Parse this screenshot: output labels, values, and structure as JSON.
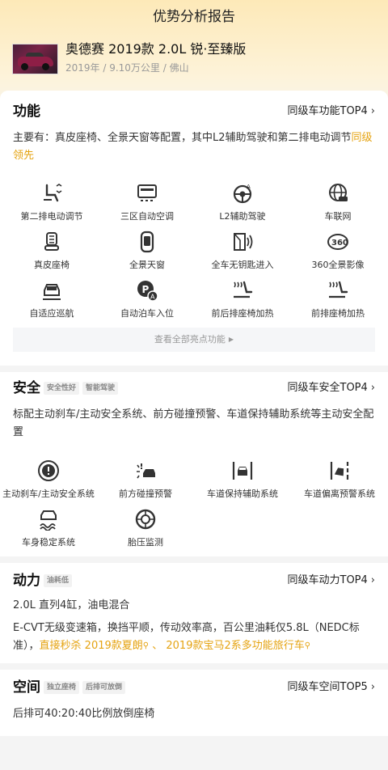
{
  "page": {
    "title": "优势分析报告"
  },
  "car": {
    "name": "奥德赛 2019款 2.0L 锐·至臻版",
    "meta": "2019年 / 9.10万公里 / 佛山"
  },
  "function_section": {
    "title": "功能",
    "link": "同级车功能TOP4",
    "summary_text": "主要有：真皮座椅、全景天窗等配置，其中L2辅助驾驶和第二排电动调节",
    "summary_highlight": "同级领先",
    "items": [
      {
        "label": "第二排电动调节",
        "icon": "power-seat-icon"
      },
      {
        "label": "三区自动空调",
        "icon": "climate-control-icon"
      },
      {
        "label": "L2辅助驾驶",
        "icon": "steering-assist-icon"
      },
      {
        "label": "车联网",
        "icon": "connected-car-icon"
      },
      {
        "label": "真皮座椅",
        "icon": "leather-seat-icon"
      },
      {
        "label": "全景天窗",
        "icon": "panoramic-sunroof-icon"
      },
      {
        "label": "全车无钥匙进入",
        "icon": "keyless-entry-icon"
      },
      {
        "label": "360全景影像",
        "icon": "camera-360-icon"
      },
      {
        "label": "自适应巡航",
        "icon": "adaptive-cruise-icon"
      },
      {
        "label": "自动泊车入位",
        "icon": "auto-parking-icon"
      },
      {
        "label": "前后排座椅加热",
        "icon": "seat-heating-icon"
      },
      {
        "label": "前排座椅加热",
        "icon": "front-seat-heating-icon"
      }
    ],
    "view_all": "查看全部亮点功能"
  },
  "safety_section": {
    "title": "安全",
    "tags": [
      "安全性好",
      "智能驾驶"
    ],
    "link": "同级车安全TOP4",
    "summary": "标配主动刹车/主动安全系统、前方碰撞预警、车道保持辅助系统等主动安全配置",
    "items": [
      {
        "label": "主动刹车/主动安全系统",
        "icon": "active-brake-icon"
      },
      {
        "label": "前方碰撞预警",
        "icon": "collision-warning-icon"
      },
      {
        "label": "车道保持辅助系统",
        "icon": "lane-keeping-icon"
      },
      {
        "label": "车道偏离预警系统",
        "icon": "lane-departure-icon"
      },
      {
        "label": "车身稳定系统",
        "icon": "stability-control-icon"
      },
      {
        "label": "胎压监测",
        "icon": "tire-pressure-icon"
      }
    ]
  },
  "power_section": {
    "title": "动力",
    "tags": [
      "油耗低"
    ],
    "link": "同级车动力TOP4",
    "line1": "2.0L 直列4缸，油电混合",
    "line2": "E-CVT无级变速箱，换挡平顺，传动效率高，百公里油耗仅5.8L（NEDC标准），",
    "compare_prefix": "直接秒杀",
    "compare_a": "2019款夏朗",
    "compare_sep": "、",
    "compare_b": "2019款宝马2系多功能旅行车"
  },
  "space_section": {
    "title": "空间",
    "tags": [
      "独立座椅",
      "后排可放倒"
    ],
    "link": "同级车空间TOP5",
    "summary": "后排可40:20:40比例放倒座椅"
  },
  "colors": {
    "highlight": "#e5a311",
    "icon": "#333333"
  }
}
